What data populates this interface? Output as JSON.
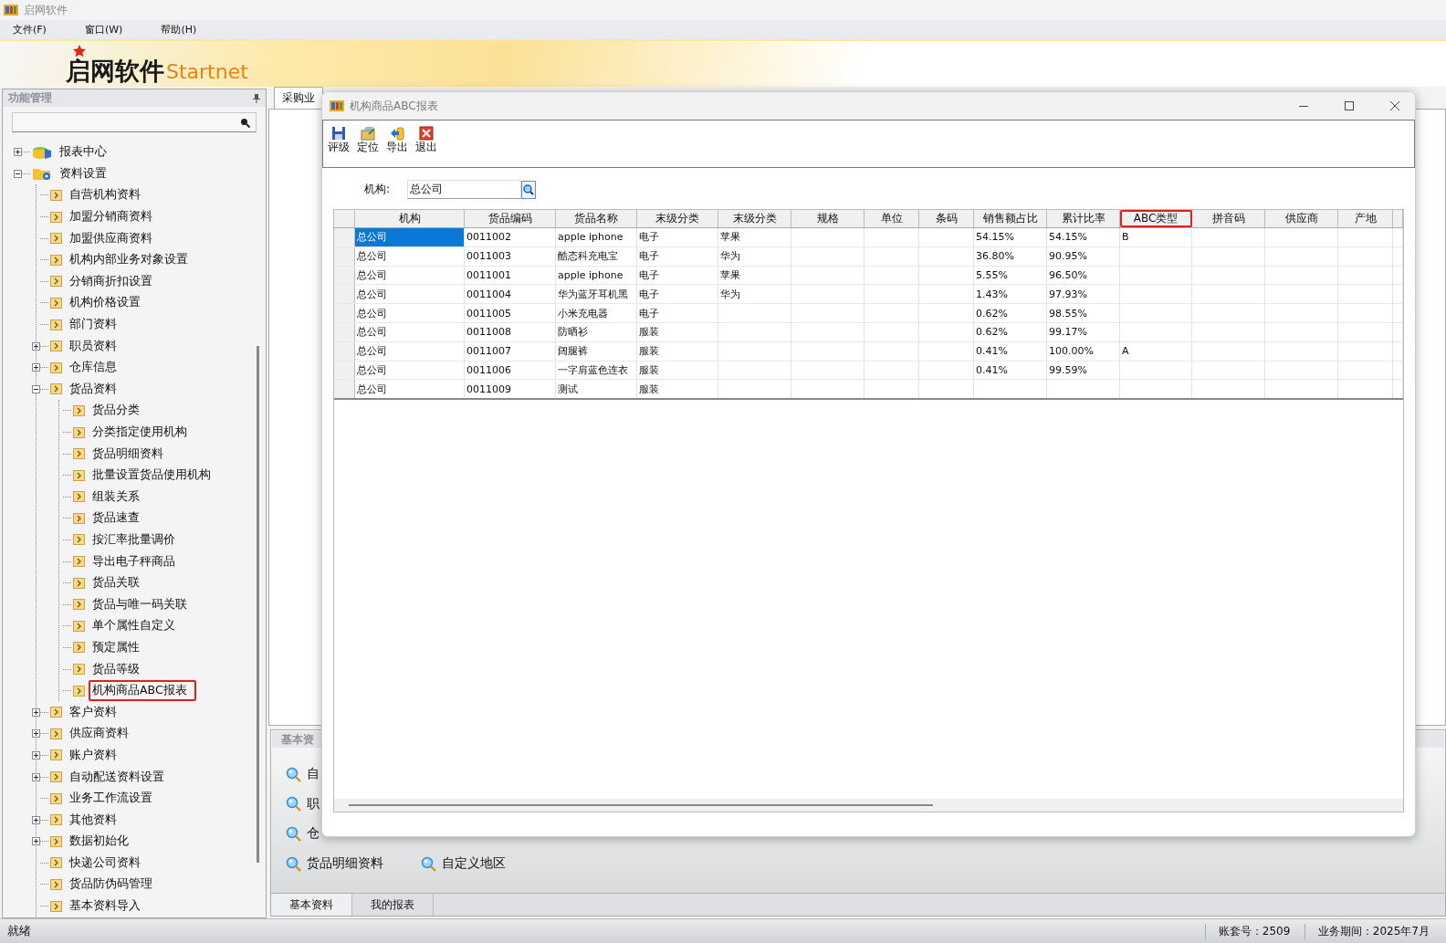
{
  "app": {
    "title": "启网软件"
  },
  "menu": [
    "文件(F)",
    "窗口(W)",
    "帮助(H)"
  ],
  "banner": {
    "name": "启网软件",
    "subtitle": "Startnet"
  },
  "function_panel": {
    "title": "功能管理",
    "tree": [
      {
        "label": "报表中心",
        "kind": "database",
        "expanded": false
      },
      {
        "label": "资料设置",
        "kind": "folder",
        "expanded": true,
        "children": [
          {
            "label": "自营机构资料",
            "kind": "page"
          },
          {
            "label": "加盟分销商资料",
            "kind": "page"
          },
          {
            "label": "加盟供应商资料",
            "kind": "page"
          },
          {
            "label": "机构内部业务对象设置",
            "kind": "page"
          },
          {
            "label": "分销商折扣设置",
            "kind": "page"
          },
          {
            "label": "机构价格设置",
            "kind": "page"
          },
          {
            "label": "部门资料",
            "kind": "page"
          },
          {
            "label": "职员资料",
            "kind": "page",
            "expanded": false
          },
          {
            "label": "仓库信息",
            "kind": "page",
            "expanded": false
          },
          {
            "label": "货品资料",
            "kind": "page",
            "expanded": true,
            "children": [
              {
                "label": "货品分类",
                "kind": "page"
              },
              {
                "label": "分类指定使用机构",
                "kind": "page"
              },
              {
                "label": "货品明细资料",
                "kind": "page"
              },
              {
                "label": "批量设置货品使用机构",
                "kind": "page"
              },
              {
                "label": "组装关系",
                "kind": "page"
              },
              {
                "label": "货品速查",
                "kind": "page"
              },
              {
                "label": "按汇率批量调价",
                "kind": "page"
              },
              {
                "label": "导出电子秤商品",
                "kind": "page"
              },
              {
                "label": "货品关联",
                "kind": "page"
              },
              {
                "label": "货品与唯一码关联",
                "kind": "page"
              },
              {
                "label": "单个属性自定义",
                "kind": "page"
              },
              {
                "label": "预定属性",
                "kind": "page"
              },
              {
                "label": "货品等级",
                "kind": "page"
              },
              {
                "label": "机构商品ABC报表",
                "kind": "page",
                "highlighted": true
              }
            ]
          },
          {
            "label": "客户资料",
            "kind": "page",
            "expanded": false
          },
          {
            "label": "供应商资料",
            "kind": "page",
            "expanded": false
          },
          {
            "label": "账户资料",
            "kind": "page",
            "expanded": false
          },
          {
            "label": "自动配送资料设置",
            "kind": "page",
            "expanded": false
          },
          {
            "label": "业务工作流设置",
            "kind": "page"
          },
          {
            "label": "其他资料",
            "kind": "page",
            "expanded": false
          },
          {
            "label": "数据初始化",
            "kind": "page",
            "expanded": false
          },
          {
            "label": "快递公司资料",
            "kind": "page"
          },
          {
            "label": "货品防伪码管理",
            "kind": "page"
          },
          {
            "label": "基本资料导入",
            "kind": "page"
          }
        ]
      }
    ]
  },
  "document_tabs": [
    {
      "label": "采购业",
      "selected": true
    }
  ],
  "basic_panel": {
    "title": "基本资",
    "links": [
      "自",
      "职",
      "仓",
      "货品明细资料",
      "自定义地区"
    ]
  },
  "bottom_tabs": [
    {
      "label": "基本资料",
      "selected": true
    },
    {
      "label": "我的报表",
      "selected": false
    }
  ],
  "status_bar": {
    "text": "就绪",
    "account": "账套号：2509",
    "period": "业务期间：2025年7月"
  },
  "dialog": {
    "title": "机构商品ABC报表",
    "toolbar": [
      {
        "label": "评级",
        "kind": "save"
      },
      {
        "label": "定位",
        "kind": "locate"
      },
      {
        "label": "导出",
        "kind": "export"
      },
      {
        "label": "退出",
        "kind": "exit"
      }
    ],
    "filter": {
      "label": "机构:",
      "value": "总公司"
    },
    "table": {
      "columns": [
        {
          "label": "机构",
          "highlighted": false
        },
        {
          "label": "货品编码",
          "highlighted": false
        },
        {
          "label": "货品名称",
          "highlighted": false
        },
        {
          "label": "末级分类",
          "highlighted": false
        },
        {
          "label": "末级分类",
          "highlighted": false
        },
        {
          "label": "规格",
          "highlighted": false
        },
        {
          "label": "单位",
          "highlighted": false
        },
        {
          "label": "条码",
          "highlighted": false
        },
        {
          "label": "销售额占比",
          "highlighted": false
        },
        {
          "label": "累计比率",
          "highlighted": false
        },
        {
          "label": "ABC类型",
          "highlighted": true
        },
        {
          "label": "拼音码",
          "highlighted": false
        },
        {
          "label": "供应商",
          "highlighted": false
        },
        {
          "label": "产地",
          "highlighted": false
        }
      ],
      "rows": [
        {
          "selected": true,
          "cells": [
            "总公司",
            "0011002",
            "apple iphone",
            "电子",
            "苹果",
            "",
            "",
            "",
            "54.15%",
            "54.15%",
            "B",
            "",
            "",
            ""
          ]
        },
        {
          "selected": false,
          "cells": [
            "总公司",
            "0011003",
            "酷态科充电宝",
            "电子",
            "华为",
            "",
            "",
            "",
            "36.80%",
            "90.95%",
            "",
            "",
            "",
            ""
          ]
        },
        {
          "selected": false,
          "cells": [
            "总公司",
            "0011001",
            "apple iphone",
            "电子",
            "苹果",
            "",
            "",
            "",
            "5.55%",
            "96.50%",
            "",
            "",
            "",
            ""
          ]
        },
        {
          "selected": false,
          "cells": [
            "总公司",
            "0011004",
            "华为蓝牙耳机黑",
            "电子",
            "华为",
            "",
            "",
            "",
            "1.43%",
            "97.93%",
            "",
            "",
            "",
            ""
          ]
        },
        {
          "selected": false,
          "cells": [
            "总公司",
            "0011005",
            "小米充电器",
            "电子",
            "",
            "",
            "",
            "",
            "0.62%",
            "98.55%",
            "",
            "",
            "",
            ""
          ]
        },
        {
          "selected": false,
          "cells": [
            "总公司",
            "0011008",
            "防晒衫",
            "服装",
            "",
            "",
            "",
            "",
            "0.62%",
            "99.17%",
            "",
            "",
            "",
            ""
          ]
        },
        {
          "selected": false,
          "cells": [
            "总公司",
            "0011007",
            "阔腿裤",
            "服装",
            "",
            "",
            "",
            "",
            "0.41%",
            "100.00%",
            "A",
            "",
            "",
            ""
          ]
        },
        {
          "selected": false,
          "cells": [
            "总公司",
            "0011006",
            "一字肩蓝色连衣",
            "服装",
            "",
            "",
            "",
            "",
            "0.41%",
            "99.59%",
            "",
            "",
            "",
            ""
          ]
        },
        {
          "selected": false,
          "cells": [
            "总公司",
            "0011009",
            "测试",
            "服装",
            "",
            "",
            "",
            "",
            "",
            "",
            "",
            "",
            "",
            ""
          ]
        }
      ]
    }
  }
}
